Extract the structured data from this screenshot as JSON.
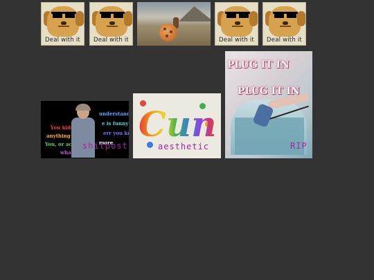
{
  "gallery": {
    "row1": [
      {
        "kind": "doge",
        "caption": "Deal with it"
      },
      {
        "kind": "doge",
        "caption": "Deal with it"
      },
      {
        "kind": "scene"
      },
      {
        "kind": "doge",
        "caption": "Deal with it"
      },
      {
        "kind": "doge",
        "caption": "Deal with it"
      }
    ],
    "lady": {
      "lines": [
        "You kids",
        "anything",
        "You, or actual",
        "what"
      ],
      "partial_lines": [
        "understand that",
        "e is funny to",
        "err you know",
        "more"
      ],
      "label": "shitpost"
    },
    "calligraphy": {
      "word": "Cunt",
      "label": "aesthetic"
    },
    "plug": {
      "headline1": "PLUG IT IN",
      "headline2": "PLUG IT IN",
      "label": "RIP"
    }
  },
  "colors": {
    "background": "#333333",
    "label": "#a424a8"
  }
}
